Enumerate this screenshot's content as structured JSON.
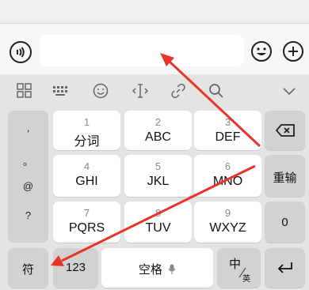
{
  "input_bar": {
    "placeholder": ""
  },
  "toolbar": {
    "icons": [
      "grid-menu-icon",
      "keyboard-icon",
      "emoji-icon",
      "cursor-move-icon",
      "link-icon",
      "search-icon",
      "collapse-chevron-icon"
    ]
  },
  "symbols": [
    ",",
    "。",
    "@",
    "?"
  ],
  "keys": {
    "k1": {
      "num": "1",
      "label": "分词"
    },
    "k2": {
      "num": "2",
      "label": "ABC"
    },
    "k3": {
      "num": "3",
      "label": "DEF"
    },
    "k4": {
      "num": "4",
      "label": "GHI"
    },
    "k5": {
      "num": "5",
      "label": "JKL"
    },
    "k6": {
      "num": "6",
      "label": "MNO"
    },
    "k7": {
      "num": "7",
      "label": "PQRS"
    },
    "k8": {
      "num": "8",
      "label": "TUV"
    },
    "k9": {
      "num": "9",
      "label": "WXYZ"
    }
  },
  "side": {
    "resend": "重输",
    "zero": "0"
  },
  "bottom": {
    "fu": "符",
    "num123": "123",
    "space": "空格",
    "zh": "中",
    "ying": "英"
  },
  "colors": {
    "arrow": "#e8352b",
    "keyboard_bg": "#e4e4e4",
    "key": "#ffffff",
    "gray_key": "#d2d2d2"
  }
}
